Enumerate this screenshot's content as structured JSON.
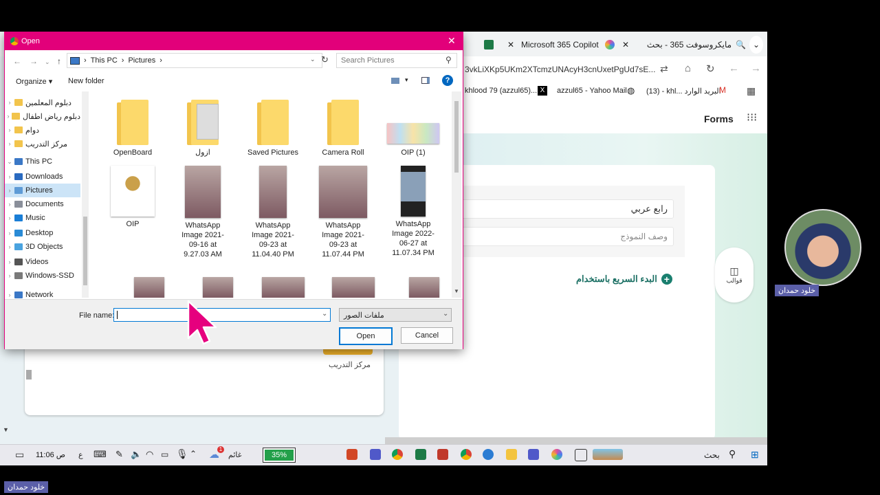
{
  "browser": {
    "tabs": [
      {
        "label": "مايكروسوفت 365 - بحث"
      },
      {
        "label": "Microsoft 365 Copilot | ..."
      }
    ],
    "url": "3vkLiXKp5UKm2XTcmzUNAcyH3cnUxetPgUd7sE...",
    "bookmarks": [
      "khlood 79 (azzul65)...",
      "azzul65 - Yahoo Mail",
      "(13) - khl... البريد الوارد"
    ],
    "forms_title": "Forms",
    "form": {
      "title_value": "رابع عربي",
      "description_placeholder": "وصف النموذج",
      "quick_start": "البدء السريع باستخدام",
      "templates_label": "قوالب"
    },
    "left_card_caption": "مركز التدريب"
  },
  "dialog": {
    "title": "Open",
    "breadcrumb": [
      "This PC",
      "Pictures"
    ],
    "search_placeholder": "Search Pictures",
    "organize": "Organize",
    "new_folder": "New folder",
    "tree": [
      {
        "label": "دبلوم المعلمين",
        "kind": "folder"
      },
      {
        "label": "دبلوم رياض اطفال",
        "kind": "folder"
      },
      {
        "label": "دوام",
        "kind": "folder"
      },
      {
        "label": "مركز التدريب",
        "kind": "folder"
      },
      {
        "label": "This PC",
        "kind": "pc"
      },
      {
        "label": "Downloads",
        "kind": "download"
      },
      {
        "label": "Pictures",
        "kind": "pictures"
      },
      {
        "label": "Documents",
        "kind": "docs"
      },
      {
        "label": "Music",
        "kind": "music"
      },
      {
        "label": "Desktop",
        "kind": "desktop"
      },
      {
        "label": "3D Objects",
        "kind": "3d"
      },
      {
        "label": "Videos",
        "kind": "video"
      },
      {
        "label": "Windows-SSD",
        "kind": "drive"
      },
      {
        "label": "Network",
        "kind": "network"
      }
    ],
    "items": [
      {
        "name": "OpenBoard",
        "kind": "folder"
      },
      {
        "name": "ازول",
        "kind": "folderphoto"
      },
      {
        "name": "Saved Pictures",
        "kind": "folder"
      },
      {
        "name": "Camera Roll",
        "kind": "folder"
      },
      {
        "name": "OIP (1)",
        "kind": "wide"
      },
      {
        "name": "OIP",
        "kind": "emblem"
      },
      {
        "name": "WhatsApp Image 2021-09-16 at 9.27.03 AM",
        "kind": "photo"
      },
      {
        "name": "WhatsApp Image 2021-09-23 at 11.04.40 PM",
        "kind": "photo"
      },
      {
        "name": "WhatsApp Image 2021-09-23 at 11.07.44 PM",
        "kind": "photo"
      },
      {
        "name": "WhatsApp Image 2022-06-27 at 11.07.34 PM",
        "kind": "phone"
      }
    ],
    "file_name_label": "File name:",
    "file_name_value": "",
    "file_type": "ملفات الصور",
    "open_label": "Open",
    "cancel_label": "Cancel"
  },
  "taskbar": {
    "time": "11:06 ص",
    "lang": "ع",
    "weather": "غائم",
    "battery": "35%",
    "search": "بحث",
    "notification_count": "1"
  },
  "overlays": {
    "presenter_name": "خلود حمدان",
    "footer_name": "خلود حمدان"
  },
  "colors": {
    "dialog_title": "#e2007a",
    "cursor": "#e6007e",
    "accent": "#0078d4"
  }
}
